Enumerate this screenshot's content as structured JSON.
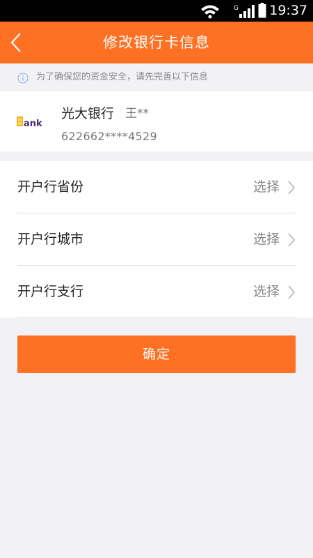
{
  "status_bar": {
    "time": "19:37",
    "network_badge": "G",
    "icons": [
      "wifi-icon",
      "signal-icon",
      "battery-icon"
    ]
  },
  "header": {
    "title": "修改银行卡信息",
    "back_icon": "chevron-left-icon",
    "background": "#fe7023"
  },
  "notice": {
    "icon": "info-circle-icon",
    "text": "为了确保您的资金安全，请先完善以下信息"
  },
  "bank_card": {
    "bank_name": "光大银行",
    "holder_name": "王**",
    "card_number": "622662****4529",
    "logo_text": "Bank"
  },
  "form": {
    "rows": [
      {
        "label": "开户行省份",
        "value": "选择"
      },
      {
        "label": "开户行城市",
        "value": "选择"
      },
      {
        "label": "开户行支行",
        "value": "选择"
      }
    ]
  },
  "confirm_button": {
    "label": "确定"
  },
  "colors": {
    "accent": "#fe7023",
    "background": "#f2f2f6",
    "text_primary": "#222222",
    "text_secondary": "#888888"
  }
}
